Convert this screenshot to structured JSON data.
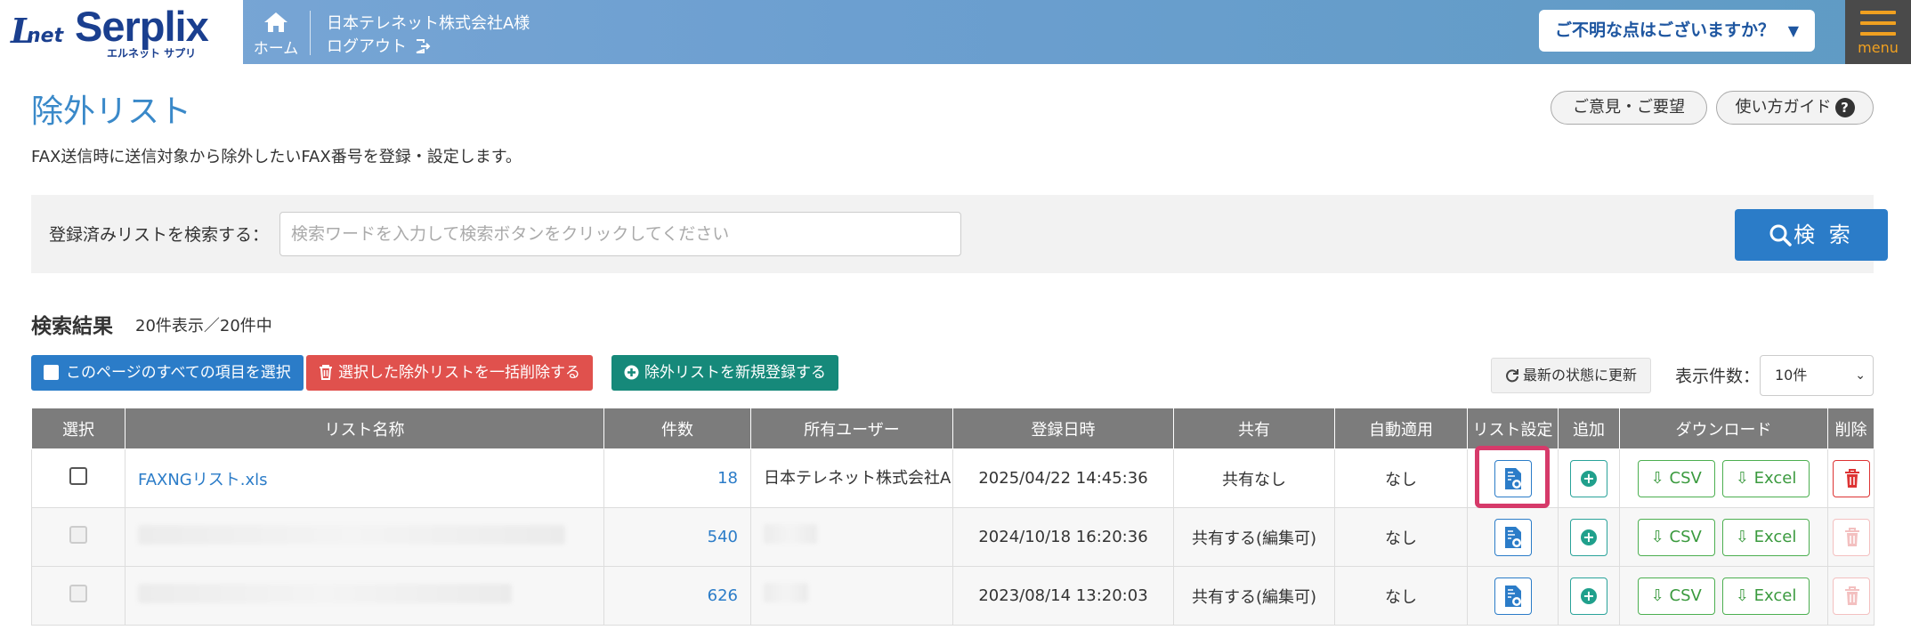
{
  "header": {
    "logo_main": "Serplix",
    "logo_l": "L",
    "logo_net": "net",
    "logo_sub": "エルネット サプリ",
    "home_label": "ホーム",
    "company": "日本テレネット株式会社A様",
    "logout": "ログアウト",
    "help": "ご不明な点はございますか？",
    "menu": "menu",
    "accent": "#6c9fd0"
  },
  "page": {
    "title": "除外リスト",
    "description": "FAX送信時に送信対象から除外したいFAX番号を登録・設定します。",
    "feedback": "ご意見・ご要望",
    "guide": "使い方ガイド"
  },
  "search": {
    "label": "登録済みリストを検索する：",
    "placeholder": "検索ワードを入力して検索ボタンをクリックしてください",
    "button": "検 索"
  },
  "results": {
    "title": "検索結果",
    "count": "20件表示／20件中",
    "select_all": "このページのすべての項目を選択",
    "bulk_delete": "選択した除外リストを一括削除する",
    "new_list": "除外リストを新規登録する",
    "refresh": "最新の状態に更新",
    "per_page_label": "表示件数：",
    "per_page_value": "10件"
  },
  "table": {
    "headers": [
      "選択",
      "リスト名称",
      "件数",
      "所有ユーザー",
      "登録日時",
      "共有",
      "自動適用",
      "リスト設定",
      "追加",
      "ダウンロード",
      "削除"
    ],
    "rows": [
      {
        "name": "FAXNGリスト.xls",
        "count": "18",
        "owner": "日本テレネット株式会社A",
        "date": "2025/04/22 14:45:36",
        "share": "共有なし",
        "auto": "なし"
      },
      {
        "name": "",
        "count": "540",
        "owner": "",
        "date": "2024/10/18 16:20:36",
        "share": "共有する(編集可)",
        "auto": "なし"
      },
      {
        "name": "",
        "count": "626",
        "owner": "",
        "date": "2023/08/14 13:20:03",
        "share": "共有する(編集可)",
        "auto": "なし"
      }
    ],
    "csv": "CSV",
    "excel": "Excel"
  }
}
